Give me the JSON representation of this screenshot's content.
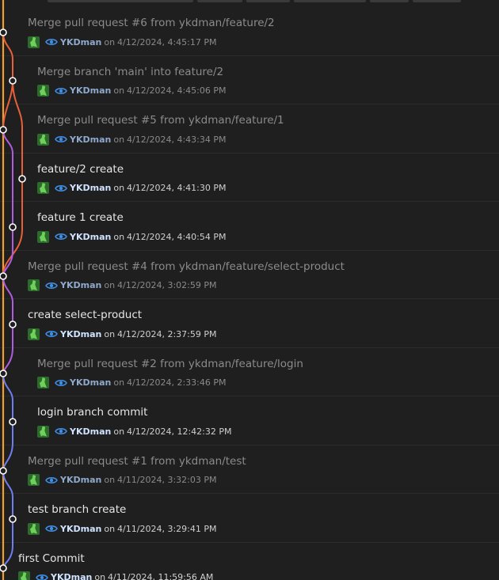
{
  "colors": {
    "background": "#1f1f1f",
    "lane_orange": "#f0a030",
    "lane_red": "#e8603a",
    "lane_purple": "#b05ce0",
    "lane_blue": "#6e7ef0",
    "author_text": "#cfe3ff",
    "eye_icon": "#3f8ee6"
  },
  "date_prefix": "on",
  "commits": [
    {
      "message": "Merge pull request #6 from ykdman/feature/2",
      "author": "YKDman",
      "date": "4/12/2024, 4:45:17 PM",
      "dimmed": true,
      "avatar_icon": "avatar-icon",
      "eye_icon": "eye-icon"
    },
    {
      "message": "Merge branch 'main' into feature/2",
      "author": "YKDman",
      "date": "4/12/2024, 4:45:06 PM",
      "dimmed": true,
      "avatar_icon": "avatar-icon",
      "eye_icon": "eye-icon"
    },
    {
      "message": "Merge pull request #5 from ykdman/feature/1",
      "author": "YKDman",
      "date": "4/12/2024, 4:43:34 PM",
      "dimmed": true,
      "avatar_icon": "avatar-icon",
      "eye_icon": "eye-icon"
    },
    {
      "message": "feature/2 create",
      "author": "YKDman",
      "date": "4/12/2024, 4:41:30 PM",
      "dimmed": false,
      "avatar_icon": "avatar-icon",
      "eye_icon": "eye-icon"
    },
    {
      "message": "feature 1 create",
      "author": "YKDman",
      "date": "4/12/2024, 4:40:54 PM",
      "dimmed": false,
      "avatar_icon": "avatar-icon",
      "eye_icon": "eye-icon"
    },
    {
      "message": "Merge pull request #4 from ykdman/feature/select-product",
      "author": "YKDman",
      "date": "4/12/2024, 3:02:59 PM",
      "dimmed": true,
      "avatar_icon": "avatar-icon",
      "eye_icon": "eye-icon"
    },
    {
      "message": "create select-product",
      "author": "YKDman",
      "date": "4/12/2024, 2:37:59 PM",
      "dimmed": false,
      "avatar_icon": "avatar-icon",
      "eye_icon": "eye-icon"
    },
    {
      "message": "Merge pull request #2 from ykdman/feature/login",
      "author": "YKDman",
      "date": "4/12/2024, 2:33:46 PM",
      "dimmed": true,
      "avatar_icon": "avatar-icon",
      "eye_icon": "eye-icon"
    },
    {
      "message": "login branch commit",
      "author": "YKDman",
      "date": "4/12/2024, 12:42:32 PM",
      "dimmed": false,
      "avatar_icon": "avatar-icon",
      "eye_icon": "eye-icon"
    },
    {
      "message": "Merge pull request #1 from ykdman/test",
      "author": "YKDman",
      "date": "4/11/2024, 3:32:03 PM",
      "dimmed": true,
      "avatar_icon": "avatar-icon",
      "eye_icon": "eye-icon"
    },
    {
      "message": "test branch create",
      "author": "YKDman",
      "date": "4/11/2024, 3:29:41 PM",
      "dimmed": false,
      "avatar_icon": "avatar-icon",
      "eye_icon": "eye-icon"
    },
    {
      "message": "first Commit",
      "author": "YKDman",
      "date": "4/11/2024, 11:59:56 AM",
      "dimmed": false,
      "avatar_icon": "avatar-icon",
      "eye_icon": "eye-icon"
    }
  ]
}
